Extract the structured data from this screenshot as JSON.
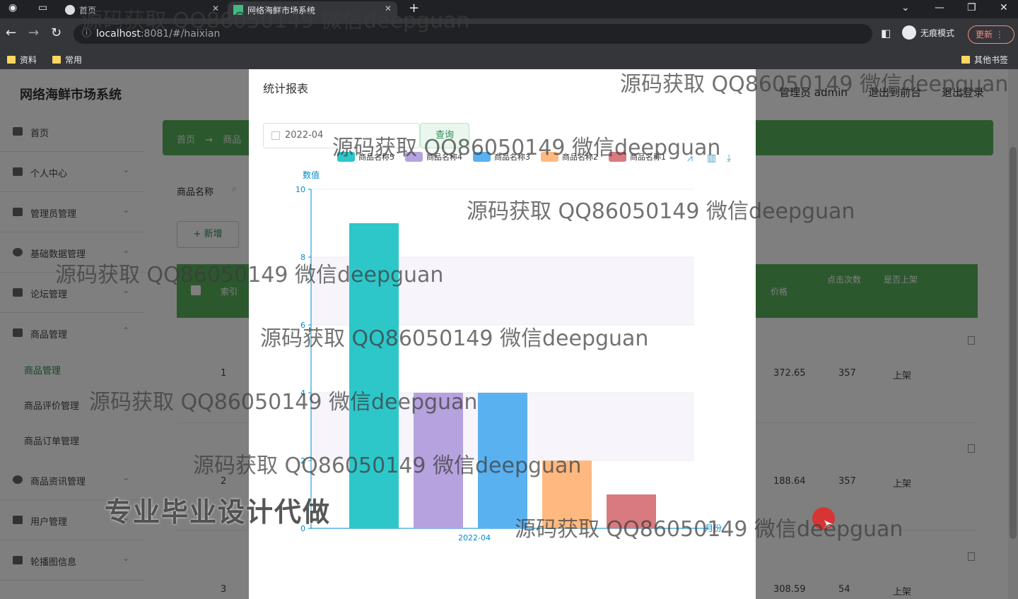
{
  "browser": {
    "tabs": [
      {
        "label": "首页"
      },
      {
        "label": "网络海鲜市场系统"
      }
    ],
    "url_host": "localhost",
    "url_path": ":8081/#/haixian",
    "incognito_label": "无痕模式",
    "update_label": "更新",
    "bookmarks": [
      "资料",
      "常用"
    ],
    "other_bookmarks": "其他书签"
  },
  "app": {
    "title": "网络海鲜市场系统",
    "admin_label": "管理员 admin",
    "back_front_label": "退出到前台",
    "logout_label": "退出登录"
  },
  "sidebar": {
    "items": [
      {
        "label": "首页"
      },
      {
        "label": "个人中心"
      },
      {
        "label": "管理员管理"
      },
      {
        "label": "基础数据管理"
      },
      {
        "label": "论坛管理"
      },
      {
        "label": "商品管理"
      },
      {
        "label": "商品资讯管理"
      },
      {
        "label": "用户管理"
      },
      {
        "label": "轮播图信息"
      }
    ],
    "sub_items": [
      "商品管理",
      "商品评价管理",
      "商品订单管理"
    ]
  },
  "page": {
    "breadcrumb_home": "首页",
    "breadcrumb_arrow": "→",
    "breadcrumb_current": "商品",
    "search_label": "商品名称",
    "add_button": "+ 新增",
    "columns": [
      "索引",
      "价格",
      "点击次数",
      "是否上架"
    ],
    "rows": [
      {
        "index": "1",
        "price": "372.65",
        "clicks": "357",
        "status": "上架"
      },
      {
        "index": "2",
        "price": "188.64",
        "clicks": "357",
        "status": "上架"
      },
      {
        "index": "3",
        "price": "308.59",
        "clicks": "54",
        "status": "上架"
      }
    ]
  },
  "modal": {
    "title": "统计报表",
    "date_value": "2022-04",
    "query_button": "查询"
  },
  "chart_data": {
    "type": "bar",
    "categories": [
      "2022-04"
    ],
    "series": [
      {
        "name": "商品名称5",
        "values": [
          9
        ],
        "color": "#2ec7c9"
      },
      {
        "name": "商品名称4",
        "values": [
          4
        ],
        "color": "#b6a2de"
      },
      {
        "name": "商品名称3",
        "values": [
          4
        ],
        "color": "#5ab1ef"
      },
      {
        "name": "商品名称2",
        "values": [
          2
        ],
        "color": "#ffb980"
      },
      {
        "name": "商品名称1",
        "values": [
          1
        ],
        "color": "#d87a80"
      }
    ],
    "xlabel": "月份",
    "ylabel": "数值",
    "ylim": [
      0,
      10
    ],
    "yticks": [
      "0",
      "2",
      "4",
      "6",
      "8",
      "10"
    ],
    "grid": true,
    "legend": "top"
  },
  "overlay_text": {
    "watermark": "源码获取 QQ86050149 微信deepguan",
    "promo": "专业毕业设计代做"
  }
}
